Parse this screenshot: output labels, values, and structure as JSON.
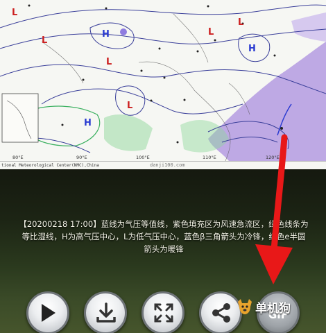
{
  "map": {
    "pressure_labels": {
      "high": "H",
      "low": "L"
    },
    "credit": "tional Meteorological Center(NMC),China",
    "lon_labels": [
      "80°E",
      "90°E",
      "100°E",
      "110°E",
      "120°E"
    ],
    "watermark": "danji100.com"
  },
  "caption": {
    "line1": "【20200218 17:00】蓝线为气压等值线，紫色填充区为风速急流区，绿色线条为",
    "line2": "等比湿线，H为高气压中心，L为低气压中心，蓝色β三角箭头为冷锋，红色e半圆",
    "line3": "箭头为暖锋"
  },
  "controls": {
    "gif_label": "GIF"
  },
  "brand": {
    "name": "单机狗"
  },
  "colors": {
    "arrow": "#e81818",
    "jet": "#b49be0",
    "isobar": "#3a3f9a",
    "humidity": "#3bb060",
    "low": "#cc1f1f"
  }
}
